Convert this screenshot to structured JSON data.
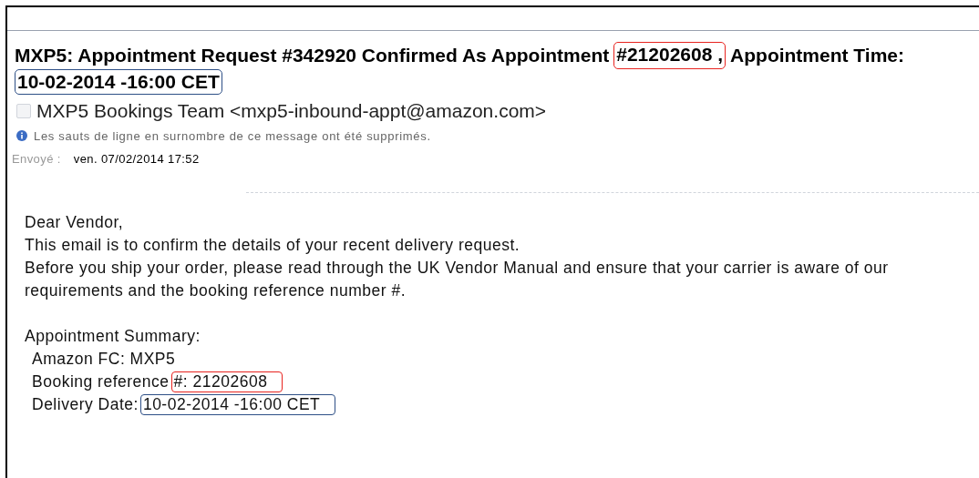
{
  "subject": [
    {
      "text": "MXP5: Appointment Request #342920 Confirmed As Appointment"
    },
    {
      "text": "#21202608 ,",
      "color": "#e8231f"
    },
    {
      "text": "Appointment Time:"
    },
    {
      "text": "10-02-2014 -16:00 CET",
      "color": "#2d4f86"
    }
  ],
  "sender": {
    "checked": false,
    "text": "MXP5 Bookings Team <mxp5-inbound-appt@amazon.com>"
  },
  "info": "Les sauts de ligne en surnombre de ce message ont été supprimés.",
  "sent": {
    "label": "Envoyé :",
    "value": "ven. 07/02/2014 17:52"
  },
  "body": [
    "Dear Vendor,",
    "This email is to confirm the details of your recent delivery request.",
    "Before you ship your order, please read through the UK Vendor Manual and ensure that your carrier is aware of our",
    "requirements and the booking reference number #."
  ],
  "summary": {
    "title": "Appointment Summary:",
    "rows": [
      {
        "label": "Amazon FC: MXP5"
      },
      {
        "label": "Booking reference",
        "value": "#: 21202608",
        "color": "#e8231f"
      },
      {
        "label": "Delivery Date:",
        "value": "10-02-2014 -16:00 CET",
        "color": "#2d4f86"
      }
    ]
  }
}
